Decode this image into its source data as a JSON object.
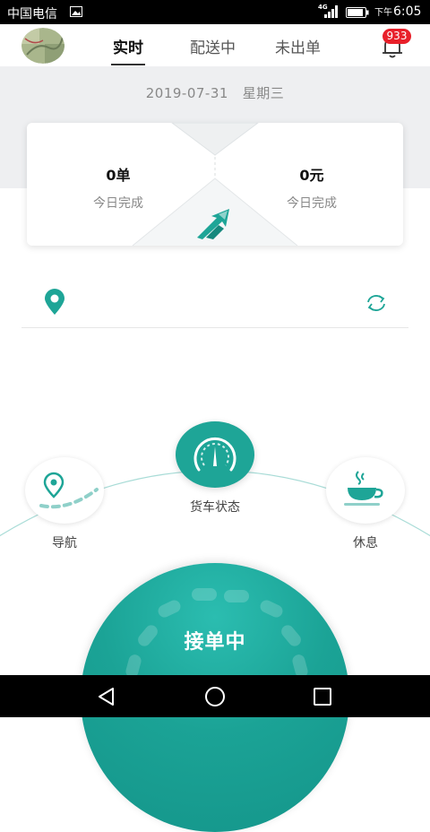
{
  "status_bar": {
    "carrier": "中国电信",
    "network": "4G",
    "time_prefix": "下午",
    "time": "6:05",
    "icons": [
      "gallery-icon",
      "signal-icon",
      "battery-icon"
    ]
  },
  "header": {
    "tabs": [
      {
        "label": "实时",
        "active": true
      },
      {
        "label": "配送中",
        "active": false
      },
      {
        "label": "未出单",
        "active": false
      }
    ],
    "notification_count": "933",
    "icons": [
      "avatar",
      "bell-icon"
    ]
  },
  "date_line": {
    "date": "2019-07-31",
    "weekday": "星期三"
  },
  "stats": {
    "orders_value": "0单",
    "orders_label": "今日完成",
    "income_value": "0元",
    "income_label": "今日完成"
  },
  "location": {
    "text": "",
    "icons": [
      "location-pin-icon",
      "refresh-icon"
    ]
  },
  "actions": {
    "navigate_label": "导航",
    "truck_status_label": "货车状态",
    "rest_label": "休息"
  },
  "accept_button": {
    "label": "接单中"
  },
  "colors": {
    "accent": "#1ea597",
    "badge": "#e8202a",
    "grey_band": "#eeeff1"
  }
}
